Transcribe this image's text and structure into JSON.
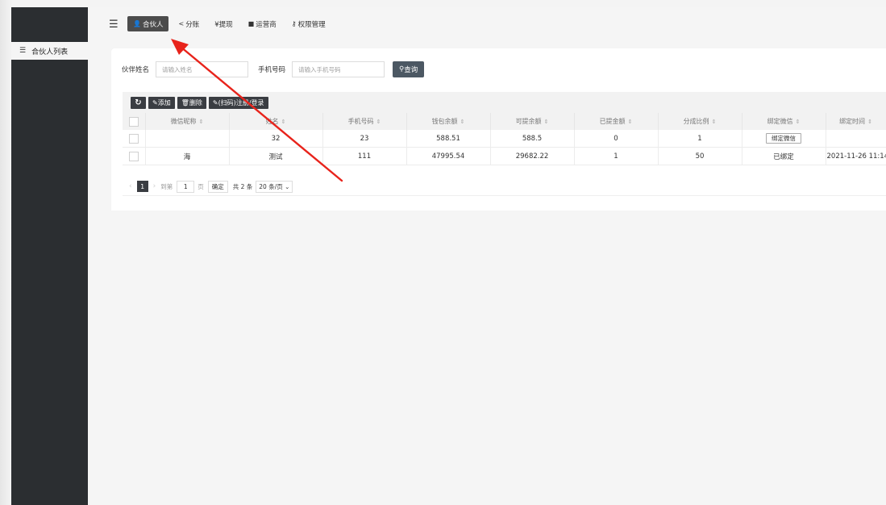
{
  "sidebar": {
    "items": [
      {
        "icon": "list-icon",
        "label": "合伙人列表"
      }
    ]
  },
  "topnav": {
    "tabs": [
      {
        "icon": "user-icon",
        "label": "合伙人",
        "active": true
      },
      {
        "icon": "share-icon",
        "label": "分账"
      },
      {
        "icon": "yen-icon",
        "label": "¥提现"
      },
      {
        "icon": "square-icon",
        "label": "运营商"
      },
      {
        "icon": "key-icon",
        "label": "权限管理"
      }
    ]
  },
  "search": {
    "name_label": "伙伴姓名",
    "name_placeholder": "请输入姓名",
    "phone_label": "手机号码",
    "phone_placeholder": "请输入手机号码",
    "query_label": "查询"
  },
  "toolbar": {
    "add_label": "添加",
    "delete_label": "删除",
    "scan_label": "(扫码)注册/登录"
  },
  "table": {
    "columns": [
      "微信昵称",
      "姓名",
      "手机号码",
      "钱包余额",
      "可提余额",
      "已提金额",
      "分成比例",
      "绑定微信",
      "绑定时间"
    ],
    "rows": [
      {
        "nick": "",
        "name": "32",
        "phone": "23",
        "wallet": "588.51",
        "withdrawable": "588.5",
        "withdrawn": "0",
        "ratio": "1",
        "wechat": "绑定微信",
        "wechat_is_button": true,
        "time": ""
      },
      {
        "nick": "海",
        "name": "测试",
        "phone": "111",
        "wallet": "47995.54",
        "withdrawable": "29682.22",
        "withdrawn": "1",
        "ratio": "50",
        "wechat": "已绑定",
        "wechat_is_button": false,
        "time": "2021-11-26 11:14"
      }
    ]
  },
  "pager": {
    "current": "1",
    "goto_label": "到第",
    "page_input": "1",
    "page_unit": "页",
    "confirm_label": "确定",
    "total": "共 2 条",
    "per_page": "20 条/页"
  },
  "colors": {
    "sidebar_bg": "#2b2e31",
    "active_tab": "#4c4c4c",
    "annotation_arrow": "#e8231b"
  }
}
